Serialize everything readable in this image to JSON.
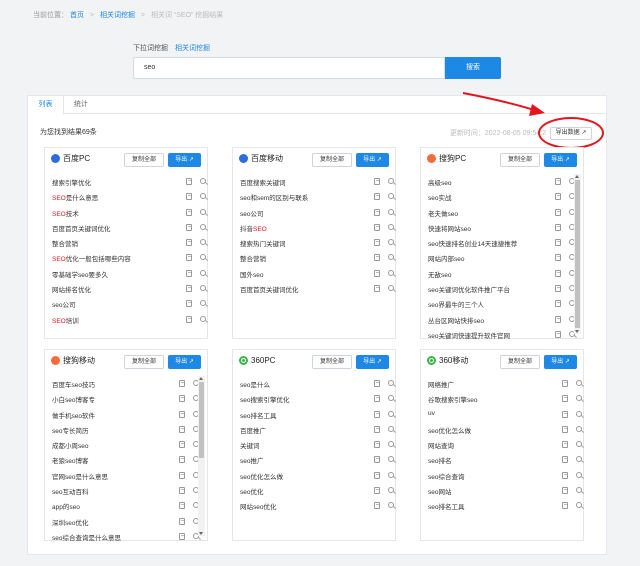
{
  "breadcrumb": {
    "prefix": "当前位置：",
    "home": "首页",
    "section": "相关词挖掘",
    "current": "相关词 “SEO” 挖掘结果"
  },
  "search": {
    "label": "下拉词挖掘",
    "related_link": "相关词挖掘",
    "value": "seo",
    "button": "搜索"
  },
  "tabs": [
    "列表",
    "统计"
  ],
  "summary": "为您找到结果69条",
  "updated": "更新时间：2022-08-05 09:54:2",
  "export_all": "导出数据",
  "copy_label": "复制全部",
  "export_label": "导出",
  "colors": {
    "accent": "#1e88e5",
    "highlight": "#e5141c",
    "baidu": "#2d6cdf",
    "sogou": "#f56b3b",
    "so360": "#3cb34a"
  },
  "cards": [
    {
      "title": "百度PC",
      "logo": "baidu-logo-icon",
      "items": [
        {
          "a": "",
          "hl": "",
          "b": "搜索引擎优化"
        },
        {
          "a": "",
          "hl": "SEO",
          "b": "是什么意思"
        },
        {
          "a": "",
          "hl": "SEO",
          "b": "技术"
        },
        {
          "a": "",
          "hl": "",
          "b": "百度首页关键词优化"
        },
        {
          "a": "",
          "hl": "",
          "b": "整合营销"
        },
        {
          "a": "",
          "hl": "SEO",
          "b": "优化一般包括哪些内容"
        },
        {
          "a": "",
          "hl": "",
          "b": "零基础学seo要多久"
        },
        {
          "a": "",
          "hl": "",
          "b": "网站排名优化"
        },
        {
          "a": "",
          "hl": "",
          "b": "seo公司"
        },
        {
          "a": "",
          "hl": "SEO",
          "b": "培训"
        }
      ]
    },
    {
      "title": "百度移动",
      "logo": "baidu-logo-icon",
      "items": [
        {
          "a": "",
          "hl": "",
          "b": "百度搜索关键词"
        },
        {
          "a": "",
          "hl": "",
          "b": "seo和sem的区别与联系"
        },
        {
          "a": "",
          "hl": "",
          "b": "seo公司"
        },
        {
          "a": "抖音",
          "hl": "SEO",
          "b": ""
        },
        {
          "a": "",
          "hl": "",
          "b": "搜索热门关键词"
        },
        {
          "a": "",
          "hl": "",
          "b": "整合营销"
        },
        {
          "a": "",
          "hl": "",
          "b": "国外seo"
        },
        {
          "a": "",
          "hl": "",
          "b": "百度首页关键词优化"
        }
      ]
    },
    {
      "title": "搜狗PC",
      "logo": "sogou-logo-icon",
      "items": [
        {
          "a": "",
          "hl": "",
          "b": "高级seo"
        },
        {
          "a": "",
          "hl": "",
          "b": "seo实战"
        },
        {
          "a": "",
          "hl": "",
          "b": "老夫做seo"
        },
        {
          "a": "",
          "hl": "",
          "b": "快速将网站seo"
        },
        {
          "a": "",
          "hl": "",
          "b": "seo快速排名创业14天速捷推荐"
        },
        {
          "a": "",
          "hl": "",
          "b": "网站内部seo"
        },
        {
          "a": "",
          "hl": "",
          "b": "无敌seo"
        },
        {
          "a": "",
          "hl": "",
          "b": "seo关键词优化软件推广平台"
        },
        {
          "a": "",
          "hl": "",
          "b": "seo界最牛的三个人"
        },
        {
          "a": "",
          "hl": "",
          "b": "丛台区网站快排seo"
        },
        {
          "a": "",
          "hl": "",
          "b": "seo关键词快速提升软件官网"
        }
      ]
    },
    {
      "title": "搜狗移动",
      "logo": "sogou-logo-icon",
      "items": [
        {
          "a": "",
          "hl": "",
          "b": "百度车seo技巧"
        },
        {
          "a": "",
          "hl": "",
          "b": "小白seo博客专"
        },
        {
          "a": "",
          "hl": "",
          "b": "做手机seo软件"
        },
        {
          "a": "",
          "hl": "",
          "b": "seo专长简历"
        },
        {
          "a": "",
          "hl": "",
          "b": "成都小周seo"
        },
        {
          "a": "",
          "hl": "",
          "b": "老狼seo博客"
        },
        {
          "a": "",
          "hl": "",
          "b": "官网seo是什么意思"
        },
        {
          "a": "",
          "hl": "",
          "b": "seo互动百科"
        },
        {
          "a": "",
          "hl": "",
          "b": "app的seo"
        },
        {
          "a": "",
          "hl": "",
          "b": "深圳seo优化"
        },
        {
          "a": "",
          "hl": "",
          "b": "seo综合查询是什么意思"
        }
      ]
    },
    {
      "title": "360PC",
      "logo": "360-logo-icon",
      "items": [
        {
          "a": "",
          "hl": "",
          "b": "seo是什么"
        },
        {
          "a": "",
          "hl": "",
          "b": "seo搜索引擎优化"
        },
        {
          "a": "",
          "hl": "",
          "b": "seo排名工具"
        },
        {
          "a": "",
          "hl": "",
          "b": "百度推广"
        },
        {
          "a": "",
          "hl": "",
          "b": "关键词"
        },
        {
          "a": "",
          "hl": "",
          "b": "seo推广"
        },
        {
          "a": "",
          "hl": "",
          "b": "seo优化怎么做"
        },
        {
          "a": "",
          "hl": "",
          "b": "seo优化"
        },
        {
          "a": "",
          "hl": "",
          "b": "网站seo优化"
        }
      ]
    },
    {
      "title": "360移动",
      "logo": "360-logo-icon",
      "items": [
        {
          "a": "",
          "hl": "",
          "b": "网络推广"
        },
        {
          "a": "",
          "hl": "",
          "b": "谷歌搜索引擎seo"
        },
        {
          "a": "",
          "hl": "",
          "b": "uv"
        },
        {
          "a": "",
          "hl": "",
          "b": "seo优化怎么做"
        },
        {
          "a": "",
          "hl": "",
          "b": "网站查询"
        },
        {
          "a": "",
          "hl": "",
          "b": "seo排名"
        },
        {
          "a": "",
          "hl": "",
          "b": "seo综合查询"
        },
        {
          "a": "",
          "hl": "",
          "b": "seo网站"
        },
        {
          "a": "",
          "hl": "",
          "b": "seo排名工具"
        }
      ]
    }
  ]
}
